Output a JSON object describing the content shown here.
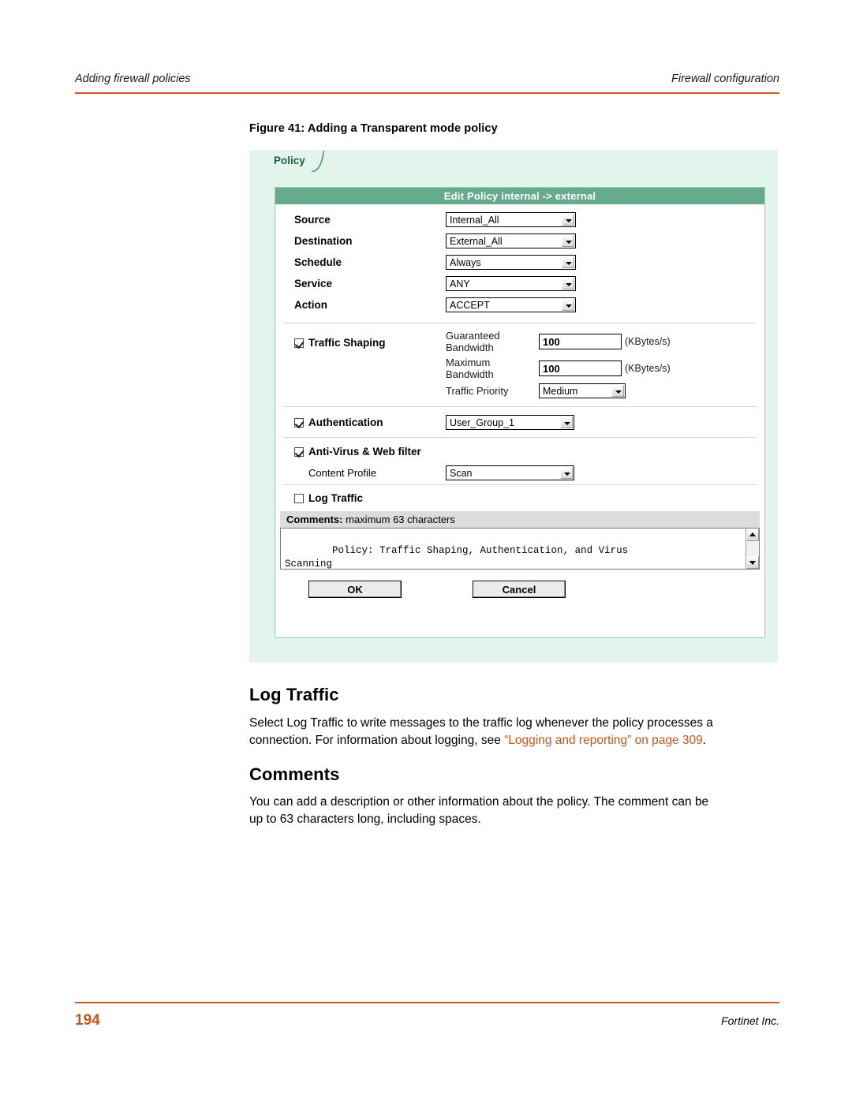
{
  "header": {
    "left": "Adding firewall policies",
    "right": "Firewall configuration"
  },
  "figure": {
    "caption": "Figure 41: Adding a Transparent mode policy",
    "tab_label": "Policy",
    "form_title": "Edit Policy internal -> external",
    "fields": [
      {
        "label": "Source",
        "value": "Internal_All"
      },
      {
        "label": "Destination",
        "value": "External_All"
      },
      {
        "label": "Schedule",
        "value": "Always"
      },
      {
        "label": "Service",
        "value": "ANY"
      },
      {
        "label": "Action",
        "value": "ACCEPT"
      }
    ],
    "traffic_shaping": {
      "label": "Traffic Shaping",
      "checked": true,
      "guaranteed_label_line1": "Guaranteed",
      "guaranteed_label_line2": "Bandwidth",
      "guaranteed_value": "100",
      "guaranteed_unit": "(KBytes/s)",
      "maximum_label_line1": "Maximum",
      "maximum_label_line2": "Bandwidth",
      "maximum_value": "100",
      "maximum_unit": "(KBytes/s)",
      "priority_label": "Traffic Priority",
      "priority_value": "Medium"
    },
    "authentication": {
      "label": "Authentication",
      "checked": true,
      "value": "User_Group_1"
    },
    "antivirus": {
      "label": "Anti-Virus & Web filter",
      "checked": true,
      "content_profile_label": "Content Profile",
      "content_profile_value": "Scan"
    },
    "log_traffic": {
      "label": "Log Traffic",
      "checked": false
    },
    "comments": {
      "bar_bold": "Comments:",
      "bar_rest": " maximum 63 characters",
      "text": "Policy: Traffic Shaping, Authentication, and Virus\nScanning"
    },
    "buttons": {
      "ok": "OK",
      "cancel": "Cancel"
    }
  },
  "sections": [
    {
      "heading": "Log Traffic",
      "paragraph_1": "Select Log Traffic to write messages to the traffic log whenever the policy processes a",
      "paragraph_2_pre": "connection. For information about logging, see ",
      "paragraph_2_link": "“Logging and reporting” on page 309",
      "paragraph_2_post": "."
    },
    {
      "heading": "Comments",
      "paragraph_1": "You can add a description or other information about the policy. The comment can be",
      "paragraph_2": "up to 63 characters long, including spaces."
    }
  ],
  "footer": {
    "page_number": "194",
    "publisher": "Fortinet Inc."
  }
}
